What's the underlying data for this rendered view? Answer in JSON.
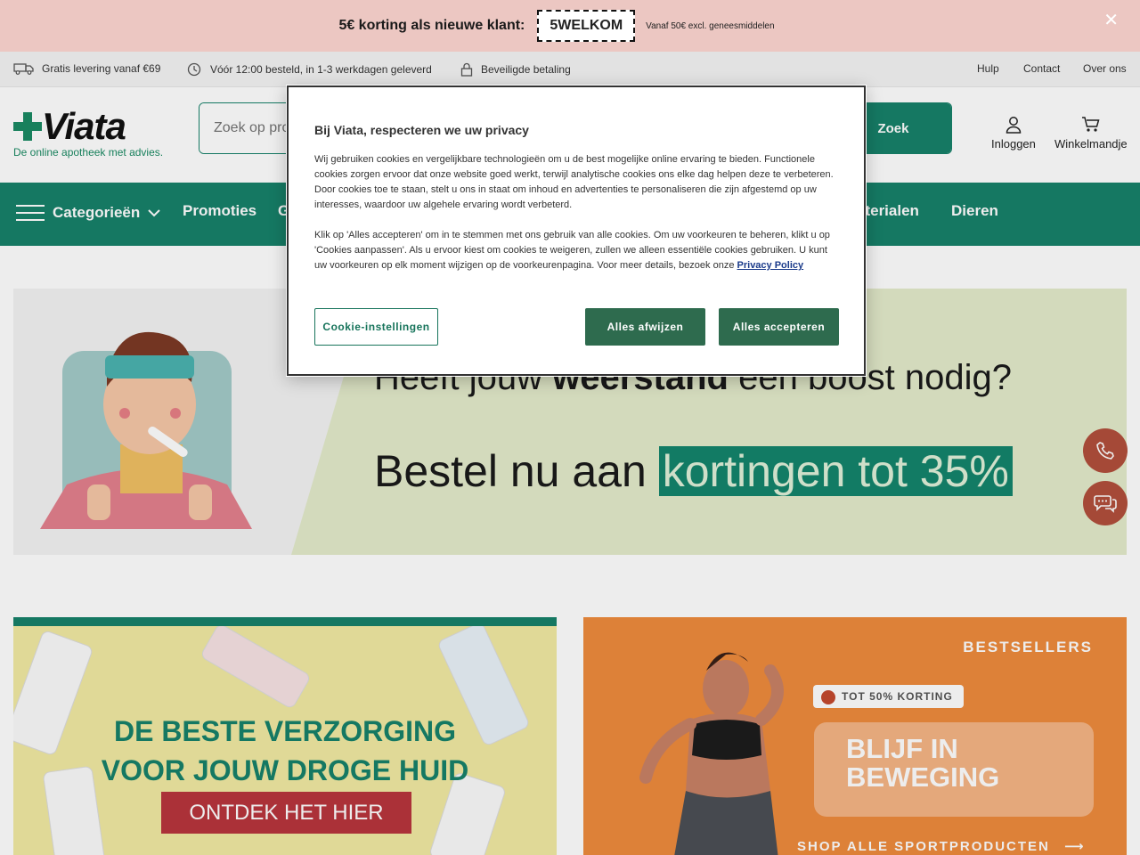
{
  "promo": {
    "text": "5€ korting als nieuwe klant:",
    "code": "5WELKOM",
    "note": "Vanaf 50€ excl. geneesmiddelen",
    "close_icon": "close-icon"
  },
  "usp": {
    "items": [
      {
        "icon": "truck-icon",
        "label": "Gratis levering vanaf €69"
      },
      {
        "icon": "clock-icon",
        "label": "Vóór 12:00 besteld, in 1-3 werkdagen geleverd"
      },
      {
        "icon": "lock-icon",
        "label": "Beveiligde betaling"
      }
    ],
    "links": [
      "Hulp",
      "Contact",
      "Over ons"
    ]
  },
  "header": {
    "logo_text": "Viata",
    "tagline": "De online apotheek met advies.",
    "search_placeholder": "Zoek op product, merk of symptoom",
    "search_button": "Zoek",
    "login_label": "Inloggen",
    "cart_label": "Winkelmandje"
  },
  "nav": {
    "categories_label": "Categorieën",
    "items": [
      "Promoties",
      "G",
      "aterialen",
      "Dieren"
    ]
  },
  "hero": {
    "line1_pre": "Heeft jouw",
    "line1_bold": "weerstand",
    "line1_post": "een boost nodig?",
    "line2_pre": "Bestel nu aan",
    "line2_highlight": "kortingen tot 35%"
  },
  "tiles": {
    "left": {
      "line1": "DE BESTE VERZORGING",
      "line2": "VOOR JOUW DROGE HUID",
      "cta": "ONTDEK HET HIER"
    },
    "right": {
      "bestsellers": "BESTSELLERS",
      "badge": "TOT 50% KORTING",
      "headline1": "BLIJF IN",
      "headline2": "BEWEGING",
      "shop": "SHOP ALLE SPORTPRODUCTEN"
    }
  },
  "cookie_modal": {
    "title": "Bij Viata, respecteren we uw privacy",
    "para1": "Wij gebruiken cookies en vergelijkbare technologieën om u de best mogelijke online ervaring te bieden. Functionele cookies zorgen ervoor dat onze website goed werkt, terwijl analytische cookies ons elke dag helpen deze te verbeteren. Door cookies toe te staan, stelt u ons in staat om inhoud en advertenties te personaliseren die zijn afgestemd op uw interesses, waardoor uw algehele ervaring wordt verbeterd.",
    "para2": "Klik op 'Alles accepteren' om in te stemmen met ons gebruik van alle cookies. Om uw voorkeuren te beheren, klikt u op 'Cookies aanpassen'. Als u ervoor kiest om cookies te weigeren, zullen we alleen essentiële cookies gebruiken. U kunt uw voorkeuren op elk moment wijzigen op de voorkeurenpagina. Voor meer details, bezoek onze",
    "privacy_link": "Privacy Policy",
    "settings_button": "Cookie-instellingen",
    "reject_button": "Alles afwijzen",
    "accept_button": "Alles accepteren"
  },
  "colors": {
    "brand_green": "#17826a",
    "promo_pink": "#ecc7c2",
    "float_red": "#b24f3c",
    "modal_button": "#2e6b4e"
  }
}
